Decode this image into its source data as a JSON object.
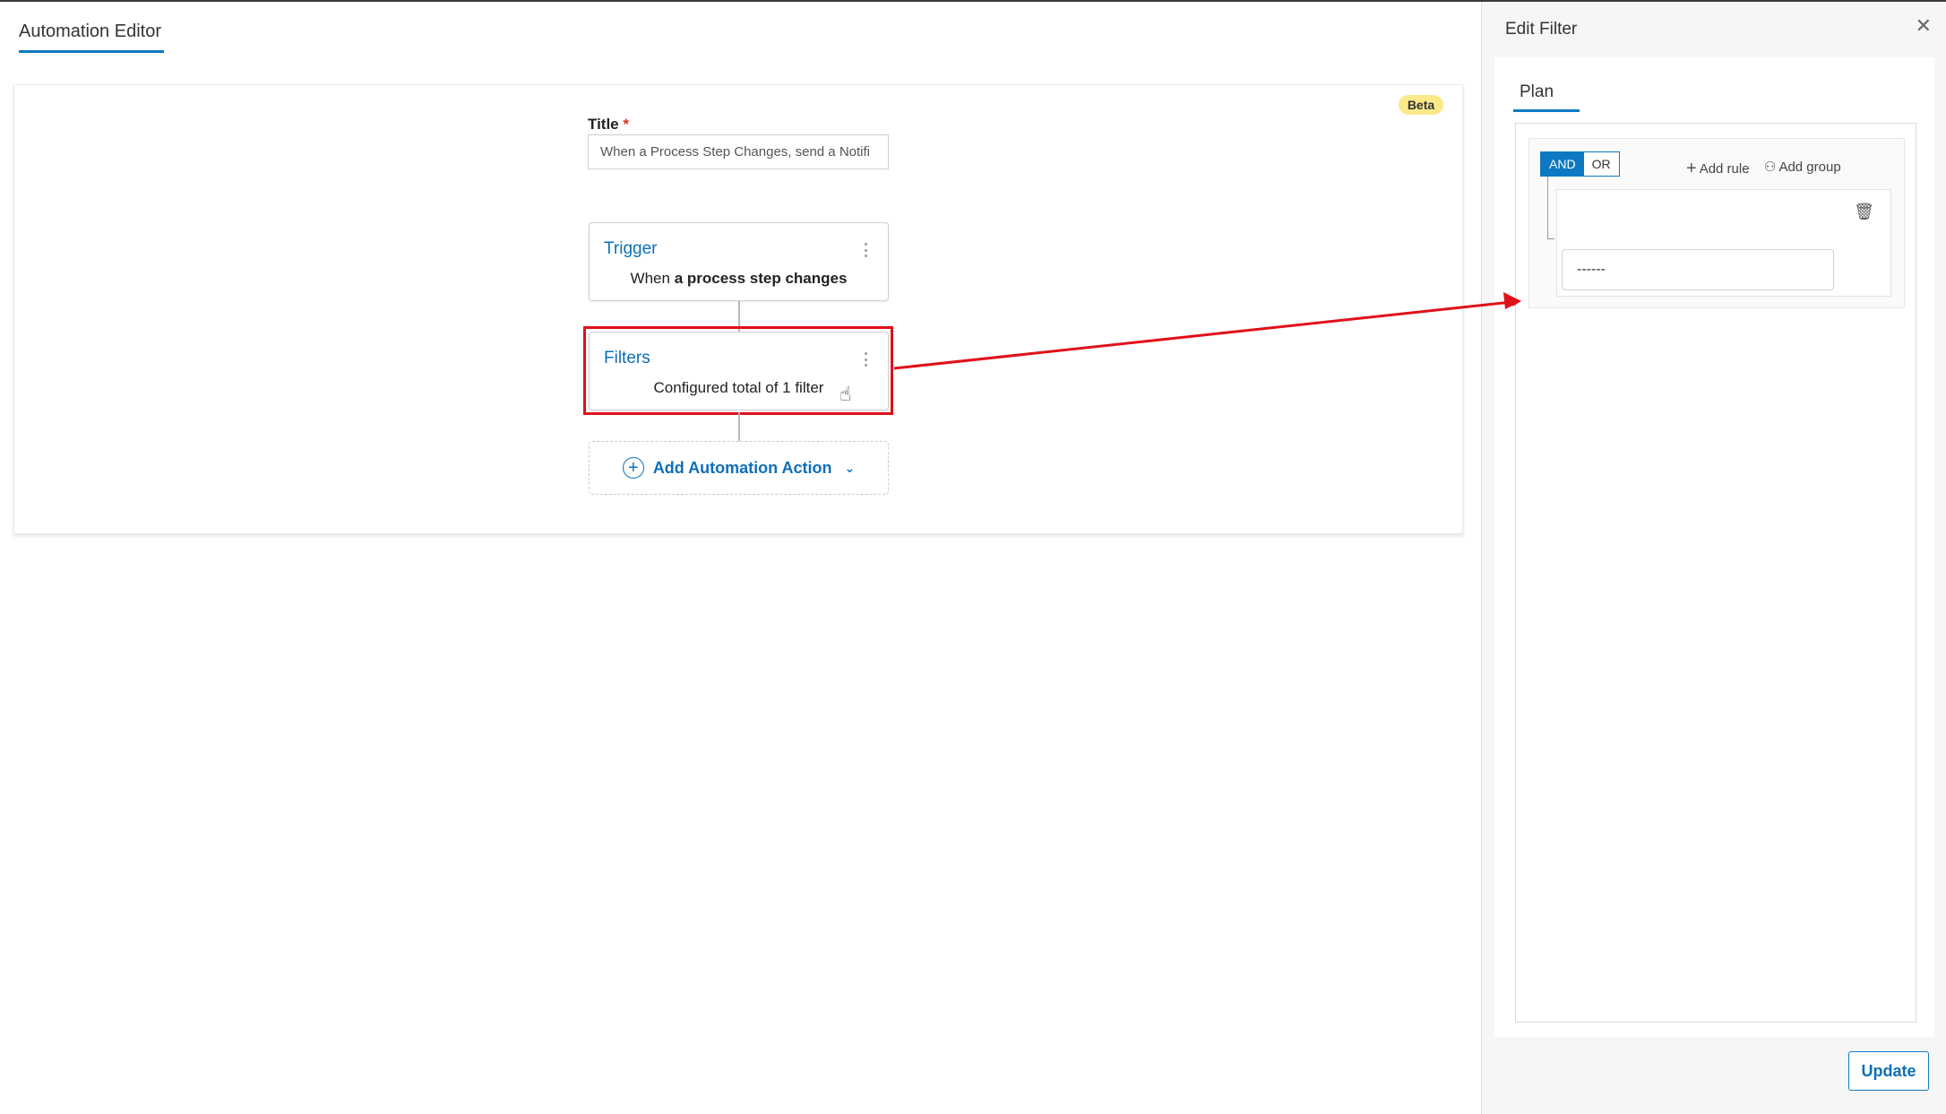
{
  "editor": {
    "tab_title": "Automation Editor",
    "beta_badge": "Beta",
    "title_label": "Title",
    "title_required_mark": "*",
    "title_value": "When a Process Step Changes, send a Notifi",
    "trigger": {
      "title": "Trigger",
      "desc_prefix": "When ",
      "desc_bold": "a process step changes"
    },
    "filters": {
      "title": "Filters",
      "desc": "Configured total of 1 filter"
    },
    "add_action_label": "Add Automation Action"
  },
  "panel": {
    "title": "Edit Filter",
    "close_glyph": "✕",
    "tab_plan": "Plan",
    "query": {
      "and_label": "AND",
      "or_label": "OR",
      "selected": "AND",
      "add_rule_label": "Add rule",
      "add_group_label": "Add group",
      "rule_select_value": "------"
    },
    "update_label": "Update"
  },
  "colors": {
    "accent": "#0e79c2",
    "highlight": "#e0101a",
    "beta_bg": "#fbe98a"
  }
}
